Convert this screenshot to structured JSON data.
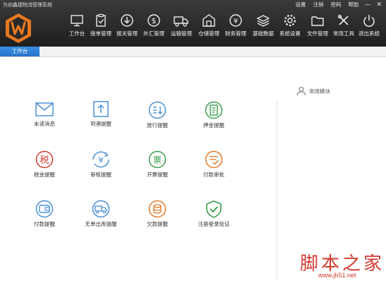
{
  "app": {
    "title": "为创鑫捷物流管理系统",
    "top_links": [
      "设置",
      "注销",
      "密码",
      "帮助"
    ],
    "window_controls": [
      "—",
      "✕"
    ]
  },
  "toolbar": [
    {
      "label": "工作台",
      "icon": "monitor-icon"
    },
    {
      "label": "接单管理",
      "icon": "clipboard-check-icon"
    },
    {
      "label": "报关管理",
      "icon": "download-circle-icon"
    },
    {
      "label": "外汇管理",
      "icon": "dollar-circle-icon"
    },
    {
      "label": "运输管理",
      "icon": "truck-icon"
    },
    {
      "label": "仓储管理",
      "icon": "warehouse-icon"
    },
    {
      "label": "财务管理",
      "icon": "yen-circle-icon"
    },
    {
      "label": "基础数据",
      "icon": "layers-icon"
    },
    {
      "label": "系统设置",
      "icon": "gear-icon"
    },
    {
      "label": "文件管理",
      "icon": "folder-icon"
    },
    {
      "label": "常用工具",
      "icon": "tools-icon"
    },
    {
      "label": "退出系统",
      "icon": "power-icon"
    }
  ],
  "tabs": [
    {
      "label": "工作台"
    }
  ],
  "tiles": [
    {
      "label": "未读消息",
      "icon": "envelope-icon"
    },
    {
      "label": "到港提醒",
      "icon": "arrow-box-icon"
    },
    {
      "label": "放行提醒",
      "icon": "release-list-icon"
    },
    {
      "label": "押金提醒",
      "icon": "deposit-doc-icon"
    },
    {
      "label": "税金提醒",
      "icon": "tax-icon",
      "glyph": "税"
    },
    {
      "label": "审核提醒",
      "icon": "yen-refresh-icon",
      "glyph": "¥"
    },
    {
      "label": "开票提醒",
      "icon": "invoice-icon",
      "glyph": "票"
    },
    {
      "label": "付款审批",
      "icon": "approval-icon"
    },
    {
      "label": "付款提醒",
      "icon": "wallet-icon"
    },
    {
      "label": "无单出库提醒",
      "icon": "outbound-truck-icon"
    },
    {
      "label": "欠款提醒",
      "icon": "debt-coins-icon"
    },
    {
      "label": "注册登录验证",
      "icon": "shield-check-icon"
    }
  ],
  "common_modules": {
    "label": "常用模块",
    "icon": "user-icon"
  },
  "watermark": {
    "text": "脚本之家",
    "url": "www.jb51.net"
  },
  "colors": {
    "topbar": "#2a2a2a",
    "accent_tab": "#2d7fd8",
    "logo_orange": "#e8781e",
    "blue_icon": "#4a8fd6",
    "red_icon": "#d63c2c",
    "green_icon": "#3a9c4a",
    "orange_icon": "#e07a2a",
    "watermark_red": "#d23b2f"
  }
}
